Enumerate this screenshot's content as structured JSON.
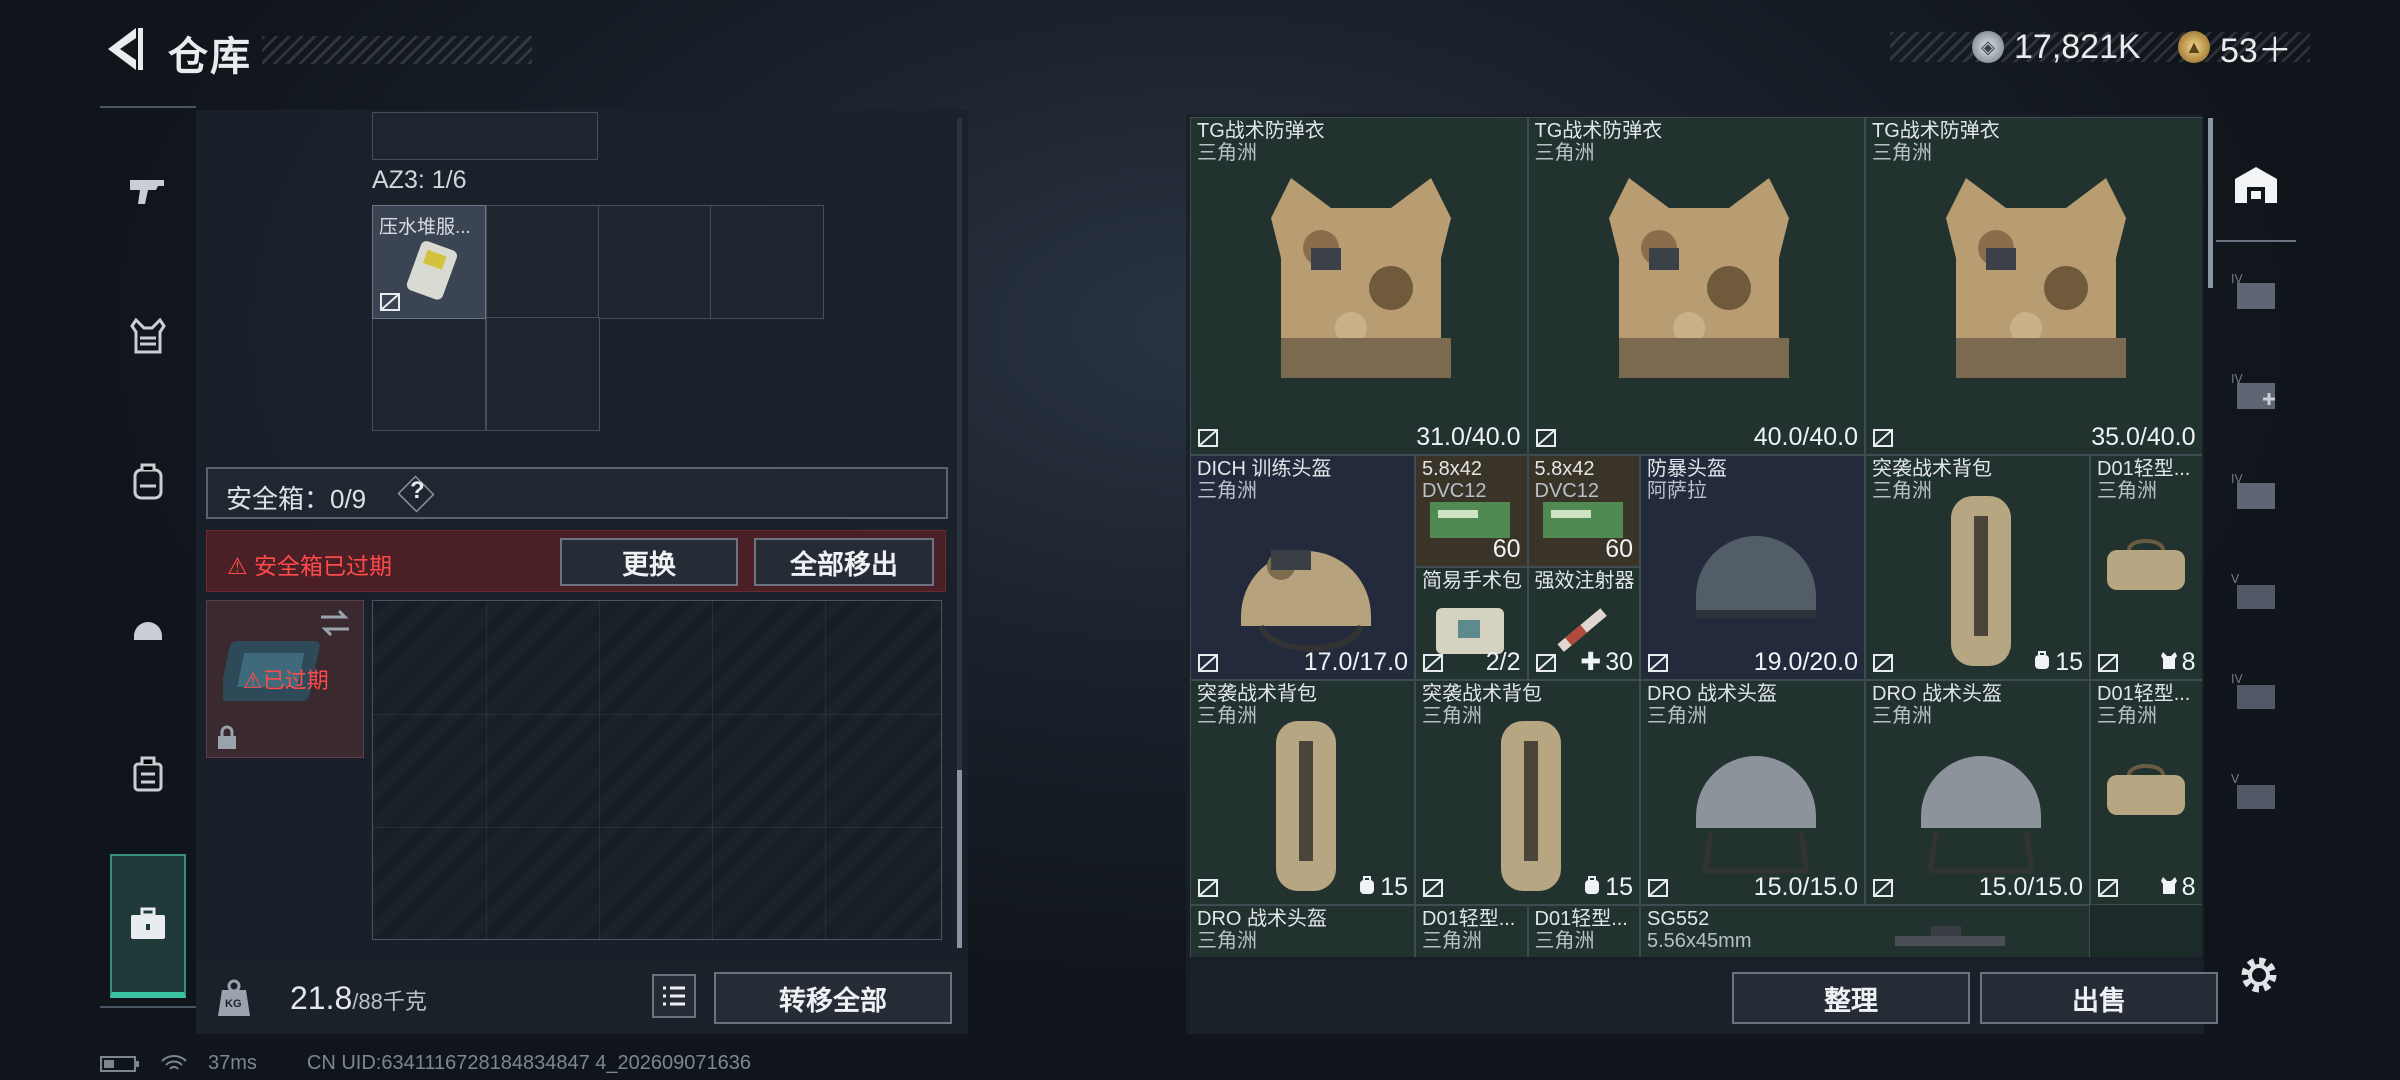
{
  "header": {
    "title": "仓库"
  },
  "currency": {
    "primary": "17,821K",
    "secondary": "53＋"
  },
  "left": {
    "container_label": "AZ3: 1/6",
    "container_item": "压水堆服...",
    "safebox_label": "安全箱：0/9",
    "safebox_help": "?",
    "safebox_warning": "安全箱已过期",
    "replace_label": "更换",
    "move_all_label": "全部移出",
    "expired_label": "已过期",
    "weight_current": "21.8",
    "weight_max": "/88千克",
    "weight_icon": "KG",
    "transfer_all_label": "转移全部"
  },
  "right": {
    "organize_label": "整理",
    "sell_label": "出售"
  },
  "items": [
    {
      "name": "TG战术防弹衣",
      "sub": "三角洲",
      "value": "31.0/40.0"
    },
    {
      "name": "TG战术防弹衣",
      "sub": "三角洲",
      "value": "40.0/40.0"
    },
    {
      "name": "TG战术防弹衣",
      "sub": "三角洲",
      "value": "35.0/40.0"
    },
    {
      "name": "DICH 训练头盔",
      "sub": "三角洲",
      "value": "17.0/17.0"
    },
    {
      "name": "5.8x42",
      "sub": "DVC12",
      "value": "60"
    },
    {
      "name": "5.8x42",
      "sub": "DVC12",
      "value": "60"
    },
    {
      "name": "防暴头盔",
      "sub": "阿萨拉",
      "value": "19.0/20.0"
    },
    {
      "name": "突袭战术背包",
      "sub": "三角洲",
      "value": "15"
    },
    {
      "name": "D01轻型...",
      "sub": "三角洲",
      "value": "8"
    },
    {
      "name": "简易手术包",
      "sub": "",
      "value": "2/2"
    },
    {
      "name": "强效注射器",
      "sub": "",
      "value": "30"
    },
    {
      "name": "突袭战术背包",
      "sub": "三角洲",
      "value": "15"
    },
    {
      "name": "突袭战术背包",
      "sub": "三角洲",
      "value": "15"
    },
    {
      "name": "DRO 战术头盔",
      "sub": "三角洲",
      "value": "15.0/15.0"
    },
    {
      "name": "DRO 战术头盔",
      "sub": "三角洲",
      "value": "15.0/15.0"
    },
    {
      "name": "D01轻型...",
      "sub": "三角洲",
      "value": "8"
    },
    {
      "name": "DRO 战术头盔",
      "sub": "三角洲",
      "value": ""
    },
    {
      "name": "D01轻型...",
      "sub": "三角洲",
      "value": ""
    },
    {
      "name": "D01轻型...",
      "sub": "三角洲",
      "value": ""
    },
    {
      "name": "SG552",
      "sub": "5.56x45mm",
      "value": ""
    }
  ],
  "status": {
    "ping": "37ms",
    "uid": "CN UID:6341116728184834847 4_202609071636"
  }
}
